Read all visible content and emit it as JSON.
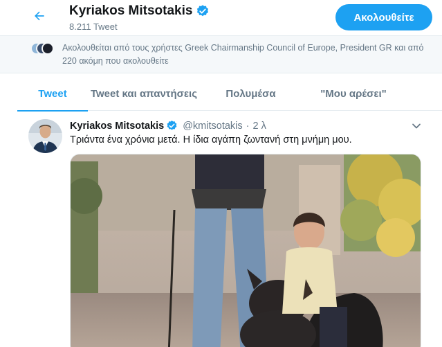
{
  "header": {
    "name": "Kyriakos Mitsotakis",
    "tweet_count": "8.211 Tweet",
    "follow_label": "Ακολουθείτε"
  },
  "followed_by": {
    "text": "Ακολουθείται από τους χρήστες Greek Chairmanship Council of Europe, President GR και από 220 ακόμη που ακολουθείτε"
  },
  "tabs": [
    {
      "label": "Tweet",
      "active": true
    },
    {
      "label": "Tweet και απαντήσεις",
      "active": false
    },
    {
      "label": "Πολυμέσα",
      "active": false
    },
    {
      "label": "\"Μου αρέσει\"",
      "active": false
    }
  ],
  "tweet": {
    "name": "Kyriakos Mitsotakis",
    "handle": "@kmitsotakis",
    "separator": "·",
    "time": "2 λ",
    "text": "Τριάντα ένα χρόνια μετά. Η ίδια αγάπη ζωντανή στη μνήμη μου."
  },
  "colors": {
    "accent": "#1da1f2",
    "secondary_text": "#657786",
    "primary_text": "#14171a"
  },
  "icons": {
    "back": "back-arrow-icon",
    "verified": "verified-badge-icon",
    "caret": "chevron-down-icon"
  }
}
